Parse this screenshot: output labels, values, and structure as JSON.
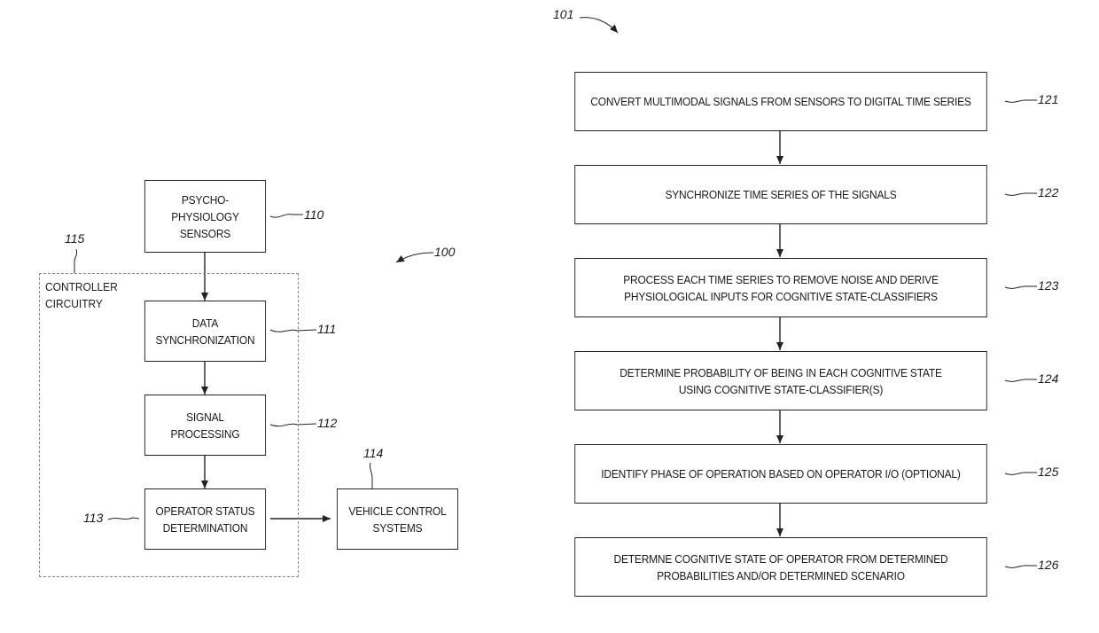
{
  "figure_left": {
    "ref_system": "100",
    "controller": {
      "ref": "115",
      "label": "CONTROLLER\nCIRCUITRY"
    },
    "blocks": [
      {
        "id": "sensors",
        "ref": "110",
        "label": "PSYCHO-\nPHYSIOLOGY\nSENSORS"
      },
      {
        "id": "data-sync",
        "ref": "111",
        "label": "DATA\nSYNCHRONIZATION"
      },
      {
        "id": "signal-processing",
        "ref": "112",
        "label": "SIGNAL\nPROCESSING"
      },
      {
        "id": "operator-status",
        "ref": "113",
        "label": "OPERATOR STATUS\nDETERMINATION"
      },
      {
        "id": "vehicle-control",
        "ref": "114",
        "label": "VEHICLE CONTROL\nSYSTEMS"
      }
    ]
  },
  "figure_right": {
    "ref_method": "101",
    "steps": [
      {
        "ref": "121",
        "label": "CONVERT MULTIMODAL SIGNALS FROM SENSORS TO DIGITAL TIME SERIES"
      },
      {
        "ref": "122",
        "label": "SYNCHRONIZE TIME SERIES OF THE SIGNALS"
      },
      {
        "ref": "123",
        "label": "PROCESS EACH TIME SERIES TO REMOVE NOISE AND DERIVE\nPHYSIOLOGICAL INPUTS FOR COGNITIVE STATE-CLASSIFIERS"
      },
      {
        "ref": "124",
        "label": "DETERMINE PROBABILITY OF BEING IN EACH COGNITIVE STATE\nUSING COGNITIVE STATE-CLASSIFIER(S)"
      },
      {
        "ref": "125",
        "label": "IDENTIFY PHASE OF OPERATION BASED ON OPERATOR I/O (OPTIONAL)"
      },
      {
        "ref": "126",
        "label": "DETERMNE COGNITIVE STATE OF OPERATOR FROM DETERMINED\nPROBABILITIES AND/OR DETERMINED SCENARIO"
      }
    ]
  }
}
